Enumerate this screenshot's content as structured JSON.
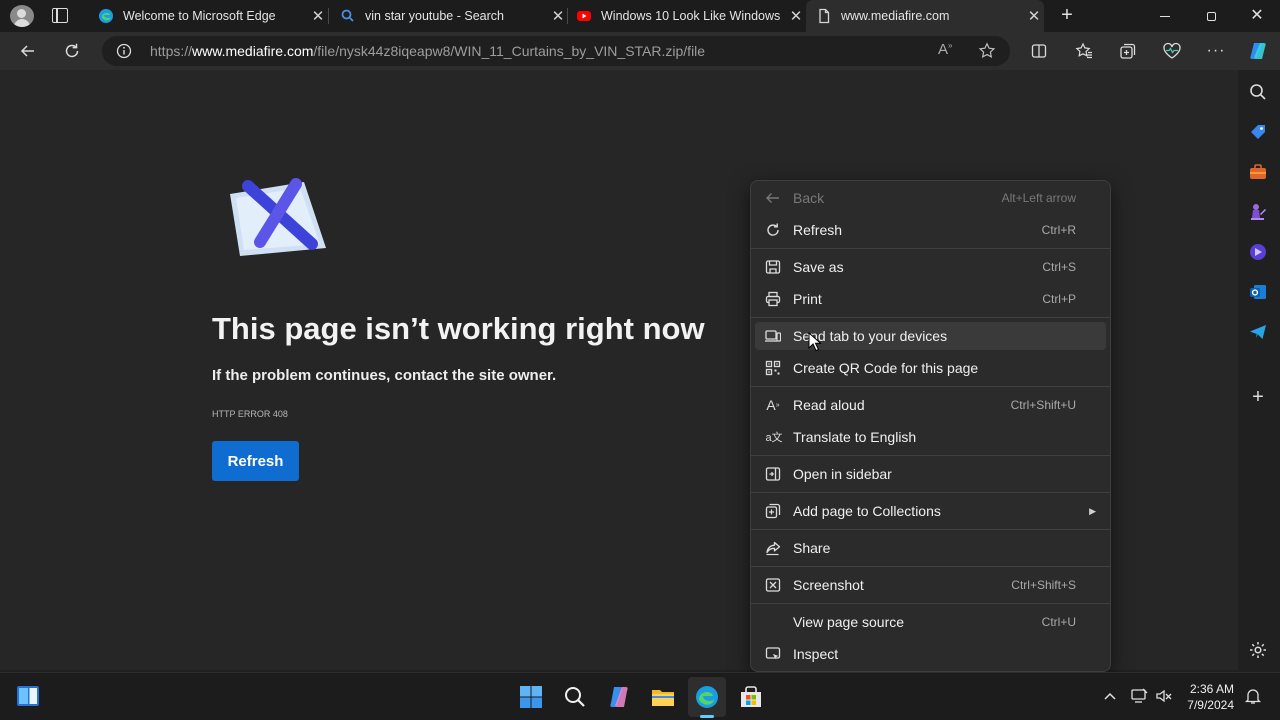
{
  "browser": {
    "tabs": [
      {
        "title": "Welcome to Microsoft Edge",
        "icon": "edge-icon"
      },
      {
        "title": "vin star youtube - Search",
        "icon": "search-icon"
      },
      {
        "title": "Windows 10 Look Like Windows",
        "icon": "youtube-icon"
      },
      {
        "title": "www.mediafire.com",
        "icon": "page-icon",
        "active": true
      }
    ],
    "address": {
      "prefix": "https://",
      "host": "www.mediafire.com",
      "path": "/file/nysk44z8iqeapw8/WIN_11_Curtains_by_VIN_STAR.zip/file"
    }
  },
  "page": {
    "title": "This page isn’t working right now",
    "subtitle": "If the problem continues, contact the site owner.",
    "error_code": "HTTP ERROR 408",
    "refresh_label": "Refresh"
  },
  "context_menu": {
    "items": [
      {
        "label": "Back",
        "shortcut": "Alt+Left arrow",
        "icon": "back-arrow-icon",
        "disabled": true
      },
      {
        "label": "Refresh",
        "shortcut": "Ctrl+R",
        "icon": "refresh-icon"
      },
      {
        "label": "Save as",
        "shortcut": "Ctrl+S",
        "icon": "save-icon"
      },
      {
        "label": "Print",
        "shortcut": "Ctrl+P",
        "icon": "print-icon"
      },
      {
        "label": "Send tab to your devices",
        "shortcut": "",
        "icon": "devices-icon",
        "highlighted": true
      },
      {
        "label": "Create QR Code for this page",
        "shortcut": "",
        "icon": "qr-code-icon"
      },
      {
        "label": "Read aloud",
        "shortcut": "Ctrl+Shift+U",
        "icon": "read-aloud-icon"
      },
      {
        "label": "Translate to English",
        "shortcut": "",
        "icon": "translate-icon"
      },
      {
        "label": "Open in sidebar",
        "shortcut": "",
        "icon": "sidebar-icon"
      },
      {
        "label": "Add page to Collections",
        "shortcut": "",
        "icon": "collections-icon",
        "submenu": true
      },
      {
        "label": "Share",
        "shortcut": "",
        "icon": "share-icon"
      },
      {
        "label": "Screenshot",
        "shortcut": "Ctrl+Shift+S",
        "icon": "screenshot-icon"
      },
      {
        "label": "View page source",
        "shortcut": "Ctrl+U",
        "icon": ""
      },
      {
        "label": "Inspect",
        "shortcut": "",
        "icon": "inspect-icon"
      }
    ]
  },
  "taskbar": {
    "time": "2:36 AM",
    "date": "7/9/2024"
  },
  "colors": {
    "accent": "#0f6cd0",
    "menu_bg": "#2b2b2b",
    "page_bg": "#262626"
  }
}
